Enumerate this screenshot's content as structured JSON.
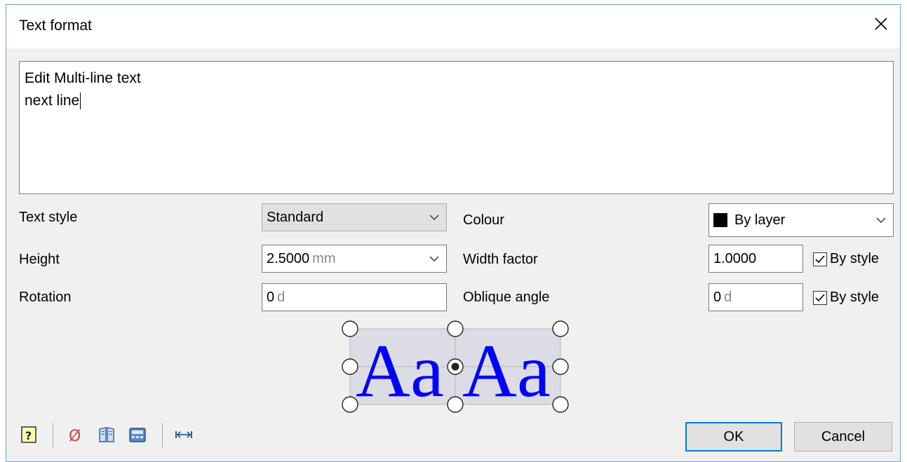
{
  "window": {
    "title": "Text format"
  },
  "editor": {
    "lines": [
      "Edit Multi-line text",
      "next line"
    ]
  },
  "form": {
    "text_style": {
      "label": "Text style",
      "value": "Standard"
    },
    "height": {
      "label": "Height",
      "value": "2.5000",
      "unit": "mm"
    },
    "rotation": {
      "label": "Rotation",
      "value": "0",
      "unit": "d"
    },
    "colour": {
      "label": "Colour",
      "value": "By layer",
      "swatch": "#000000"
    },
    "width_factor": {
      "label": "Width factor",
      "value": "1.0000",
      "by_style_label": "By style",
      "by_style_checked": true
    },
    "oblique_angle": {
      "label": "Oblique angle",
      "value": "0",
      "unit": "d",
      "by_style_label": "By style",
      "by_style_checked": true
    }
  },
  "preview": {
    "sample_text": "Aa",
    "text_color": "#0000ff",
    "bg_color": "#dcdce4"
  },
  "toolbar": {
    "icons": [
      "help-icon",
      "diameter-symbol-icon",
      "book-icon",
      "calculator-icon",
      "width-arrows-icon"
    ],
    "diameter_symbol": "Ø",
    "diameter_color": "#d04040"
  },
  "buttons": {
    "ok": "OK",
    "cancel": "Cancel"
  }
}
